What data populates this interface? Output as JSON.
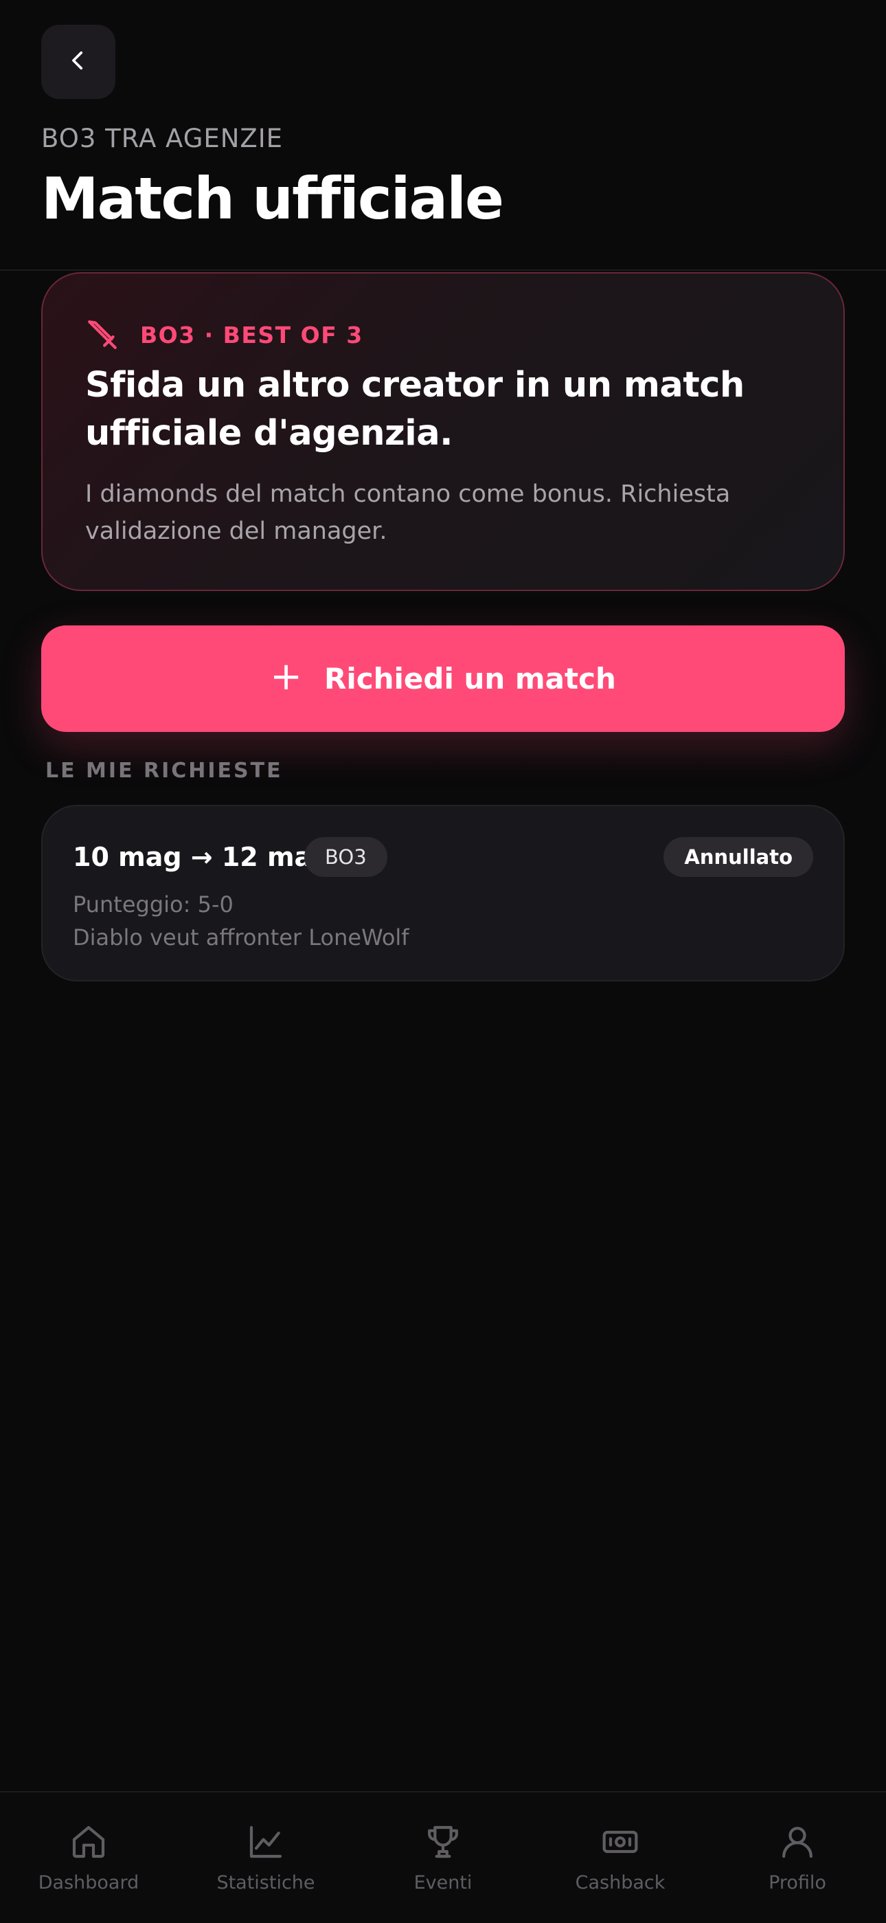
{
  "header": {
    "back_icon": "chevron-left-icon",
    "eyebrow": "BO3 TRA AGENZIE",
    "title": "Match ufficiale"
  },
  "hero": {
    "icon": "sword-icon",
    "tag": "BO3 · BEST OF 3",
    "heading": "Sfida un altro creator in un match ufficiale d'agenzia.",
    "description": "I diamonds del match contano come bonus. Richiesta validazione del manager."
  },
  "cta": {
    "icon": "plus-icon",
    "icon_glyph": "+",
    "label": "Richiedi un match"
  },
  "requests": {
    "section_label": "LE MIE RICHIESTE",
    "items": [
      {
        "dates": "10 mag → 12 mag",
        "type": "BO3",
        "status": "Annullato",
        "score": "Punteggio: 5-0",
        "note": "Diablo veut affronter LoneWolf"
      }
    ]
  },
  "nav": {
    "items": [
      {
        "label": "Dashboard",
        "icon": "home-icon"
      },
      {
        "label": "Statistiche",
        "icon": "chart-icon"
      },
      {
        "label": "Eventi",
        "icon": "trophy-icon"
      },
      {
        "label": "Cashback",
        "icon": "cash-icon"
      },
      {
        "label": "Profilo",
        "icon": "user-icon"
      }
    ]
  },
  "colors": {
    "background": "#0a0a0b",
    "accent": "#ff4a78",
    "card": "#18171b",
    "muted_text": "#7a787d"
  }
}
